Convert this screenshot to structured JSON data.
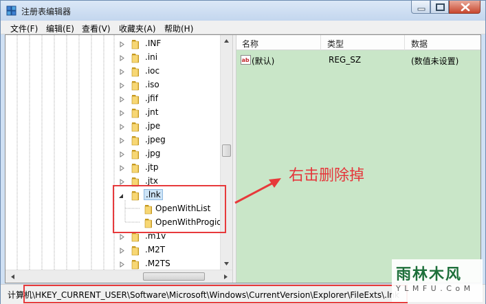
{
  "window": {
    "title": "注册表编辑器"
  },
  "menu": [
    "文件(F)",
    "编辑(E)",
    "查看(V)",
    "收藏夹(A)",
    "帮助(H)"
  ],
  "tree": {
    "items": [
      ".INF",
      ".ini",
      ".ioc",
      ".iso",
      ".jfif",
      ".jnt",
      ".jpe",
      ".jpeg",
      ".jpg",
      ".jtp",
      ".jtx"
    ],
    "selected": ".lnk",
    "children": [
      "OpenWithList",
      "OpenWithProgid"
    ],
    "after": [
      ".m1v",
      ".M2T",
      ".M2TS"
    ]
  },
  "list": {
    "headers": {
      "name": "名称",
      "type": "类型",
      "data": "数据"
    },
    "rows": [
      {
        "name": "(默认)",
        "type": "REG_SZ",
        "data": "(数值未设置)"
      }
    ]
  },
  "annotation": {
    "text": "右击删除掉"
  },
  "status": {
    "path": "计算机\\HKEY_CURRENT_USER\\Software\\Microsoft\\Windows\\CurrentVersion\\Explorer\\FileExts\\.lnk"
  },
  "watermark": {
    "title": "雨林木风",
    "subtitle": "Y L M F U . C o M"
  },
  "colors": {
    "accent_red": "#e7393b",
    "list_bg": "#c9e6c8",
    "selection": "#cde4f7"
  }
}
